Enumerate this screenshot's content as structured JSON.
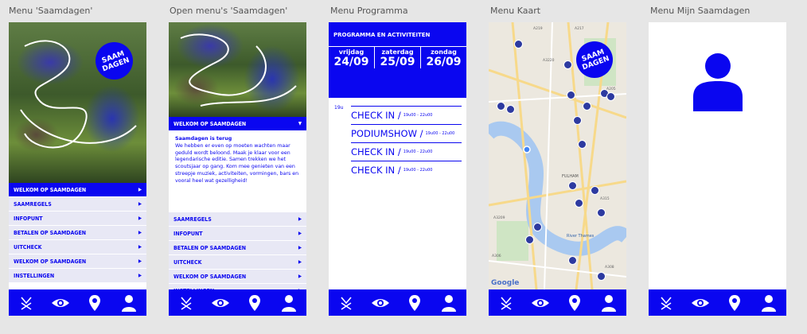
{
  "captions": [
    "Menu 'Saamdagen'",
    "Open menu's 'Saamdagen'",
    "Menu Programma",
    "Menu Kaart",
    "Menu Mijn Saamdagen"
  ],
  "logo": {
    "text": "SAAM DAGEN"
  },
  "colors": {
    "brand": "#0a06f0",
    "menu_bg": "#e8e8f5"
  },
  "tabbar": [
    {
      "icon": "logo-icon"
    },
    {
      "icon": "eye-icon"
    },
    {
      "icon": "map-pin-icon"
    },
    {
      "icon": "user-icon"
    }
  ],
  "screen1": {
    "menu": [
      {
        "label": "WELKOM OP SAAMDAGEN",
        "active": true
      },
      {
        "label": "SAAMREGELS"
      },
      {
        "label": "INFOPUNT"
      },
      {
        "label": "BETALEN OP SAAMDAGEN"
      },
      {
        "label": "UITCHECK"
      },
      {
        "label": "WELKOM OP SAAMDAGEN"
      },
      {
        "label": "INSTELLINGEN"
      }
    ]
  },
  "screen2": {
    "open_item": "WELKOM OP SAAMDAGEN",
    "body_title": "Saamdagen is terug",
    "body_text": "We hebben er even op moeten wachten maar geduld wordt beloond. Maak je klaar voor een legendarische editie. Samen trekken we het scoutsjaar op gang. Kom mee genieten van een streepje muziek, activiteiten, vormingen, bars en vooral heel wat gezelligheid!",
    "menu": [
      "SAAMREGELS",
      "INFOPUNT",
      "BETALEN OP SAAMDAGEN",
      "UITCHECK",
      "WELKOM OP SAAMDAGEN",
      "INSTELLINGEN"
    ]
  },
  "screen3": {
    "title": "PROGRAMMA EN ACTIVITEITEN",
    "days": [
      {
        "name": "vrijdag",
        "date": "24/09"
      },
      {
        "name": "zaterdag",
        "date": "25/09"
      },
      {
        "name": "zondag",
        "date": "26/09"
      }
    ],
    "hour": "19u",
    "events": [
      {
        "title": "CHECK IN /",
        "time": "19u00 - 22u00"
      },
      {
        "title": "PODIUMSHOW /",
        "time": "19u00 - 22u00"
      },
      {
        "title": "CHECK IN /",
        "time": "19u00 - 22u00"
      },
      {
        "title": "CHECK IN /",
        "time": "19u00 - 22u00"
      }
    ]
  },
  "screen4": {
    "map_labels": [
      "FULHAM",
      "River Thames",
      "A205",
      "A3220",
      "A217",
      "A219",
      "A306",
      "A308",
      "A3209",
      "A315"
    ],
    "google": "Google"
  }
}
